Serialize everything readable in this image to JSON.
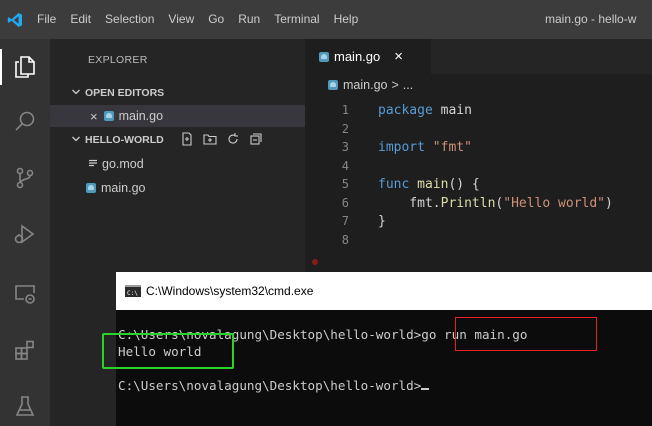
{
  "titlebar": {
    "menu": [
      "File",
      "Edit",
      "Selection",
      "View",
      "Go",
      "Run",
      "Terminal",
      "Help"
    ],
    "window_title": "main.go - hello-w"
  },
  "activity_bar": {
    "icons": [
      "files-icon",
      "search-icon",
      "source-control-icon",
      "run-debug-icon",
      "remote-explorer-icon",
      "extensions-icon",
      "testing-icon"
    ]
  },
  "sidebar": {
    "title": "EXPLORER",
    "open_editors_label": "OPEN EDITORS",
    "open_editors": [
      {
        "close": "×",
        "name": "main.go"
      }
    ],
    "folder_label": "HELLO-WORLD",
    "files": [
      {
        "name": "go.mod",
        "icon": "settings-lines-icon"
      },
      {
        "name": "main.go",
        "icon": "go-gopher-icon"
      }
    ]
  },
  "editor": {
    "tab": {
      "label": "main.go",
      "close": "×"
    },
    "breadcrumb": {
      "file": "main.go",
      "sep": ">",
      "more": "..."
    },
    "lines": [
      {
        "n": "1",
        "parts": [
          {
            "t": "package ",
            "c": "kw"
          },
          {
            "t": "main",
            "c": "plain"
          }
        ]
      },
      {
        "n": "2",
        "parts": []
      },
      {
        "n": "3",
        "parts": [
          {
            "t": "import ",
            "c": "kw"
          },
          {
            "t": "\"fmt\"",
            "c": "str"
          }
        ]
      },
      {
        "n": "4",
        "parts": []
      },
      {
        "n": "5",
        "parts": [
          {
            "t": "func ",
            "c": "kw"
          },
          {
            "t": "main",
            "c": "fn"
          },
          {
            "t": "() {",
            "c": "plain"
          }
        ]
      },
      {
        "n": "6",
        "parts": [
          {
            "t": "    fmt.",
            "c": "plain"
          },
          {
            "t": "Println",
            "c": "fn"
          },
          {
            "t": "(",
            "c": "plain"
          },
          {
            "t": "\"Hello world\"",
            "c": "str"
          },
          {
            "t": ")",
            "c": "plain"
          }
        ]
      },
      {
        "n": "7",
        "parts": [
          {
            "t": "}",
            "c": "plain"
          }
        ]
      },
      {
        "n": "8",
        "parts": []
      }
    ]
  },
  "cmd": {
    "title": "C:\\Windows\\system32\\cmd.exe",
    "line1_prompt": "C:\\Users\\novalagung\\Desktop\\hello-world>",
    "line1_command": "go run main.go",
    "output": "Hello world",
    "line3_prompt": "C:\\Users\\novalagung\\Desktop\\hello-world>"
  },
  "colors": {
    "titlebar": "#3c3c3c",
    "activitybar": "#333333",
    "sidebar": "#252526",
    "editor": "#1e1e1e",
    "highlight_red": "#e81f23",
    "highlight_green": "#2ad32a"
  }
}
